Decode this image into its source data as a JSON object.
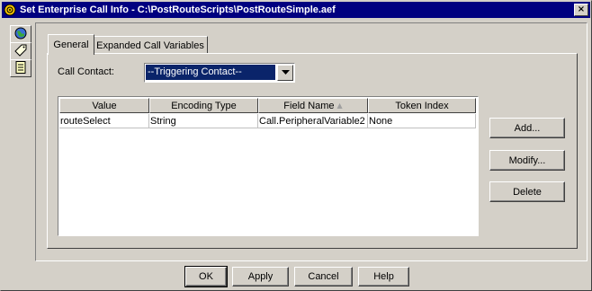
{
  "window": {
    "title": "Set Enterprise Call Info - C:\\PostRouteScripts\\PostRouteSimple.aef",
    "close_glyph": "×",
    "icon": "app-icon"
  },
  "side_tools": [
    {
      "icon": "globe-icon"
    },
    {
      "icon": "tag-icon"
    },
    {
      "icon": "document-icon"
    }
  ],
  "tabs": [
    {
      "label": "General",
      "active": true
    },
    {
      "label": "Expanded Call Variables",
      "active": false
    }
  ],
  "call_contact": {
    "label": "Call Contact:",
    "value": "--Triggering Contact--"
  },
  "table": {
    "columns": [
      "Value",
      "Encoding Type",
      "Field Name",
      "Token Index"
    ],
    "sort_indicator": "▲",
    "rows": [
      [
        "routeSelect",
        "String",
        "Call.PeripheralVariable2",
        "None"
      ]
    ]
  },
  "side_buttons": {
    "add": "Add...",
    "modify": "Modify...",
    "delete": "Delete"
  },
  "footer_buttons": {
    "ok": "OK",
    "apply": "Apply",
    "cancel": "Cancel",
    "help": "Help"
  },
  "colors": {
    "titlebar": "#000080",
    "face": "#d4d0c8",
    "selection": "#0a246a"
  }
}
